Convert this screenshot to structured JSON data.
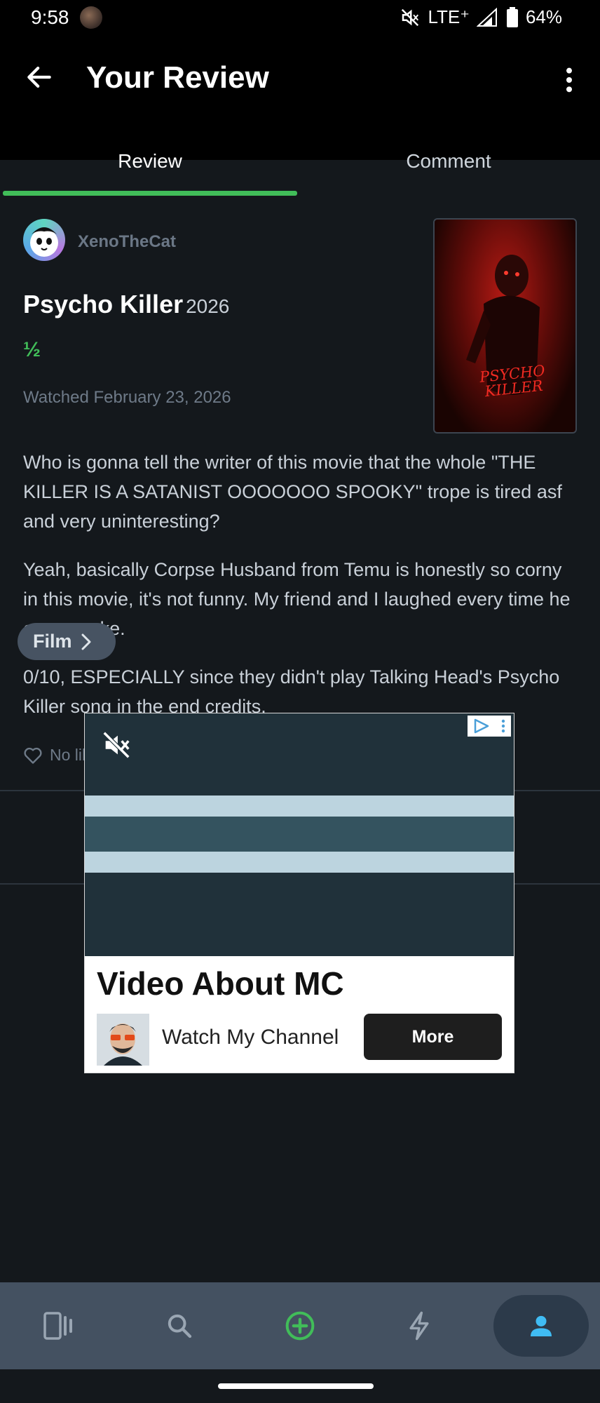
{
  "status_bar": {
    "time": "9:58",
    "network": "LTE⁺",
    "battery": "64%",
    "icons": [
      "avatar",
      "mute-icon",
      "signal-icon",
      "battery-icon"
    ]
  },
  "app_bar": {
    "title": "Your Review",
    "back_icon": "arrow-left-icon",
    "menu_icon": "more-vertical-icon"
  },
  "tabs": [
    {
      "label": "Review",
      "active": true
    },
    {
      "label": "Comment",
      "active": false
    }
  ],
  "review": {
    "username": "XenoTheCat",
    "film_title": "Psycho Killer",
    "year": "2026",
    "rating": "½",
    "watched": "Watched February 23, 2026",
    "poster_text": "PSYCHO KILLER",
    "paragraphs": [
      "Who is gonna tell the writer of this movie that the whole \"THE KILLER IS A SATANIST OOOOOOO SPOOKY\" trope is tired asf and very uninteresting?",
      "Yeah, basically Corpse Husband from Temu is honestly so corny in this movie, it's not funny. My friend and I laughed every time he even spoke.",
      "0/10, ESPECIALLY since they didn't play Talking Head's Psycho Killer song in the end credits."
    ],
    "likes": "No likes yet"
  },
  "chip": {
    "label": "Film"
  },
  "ad": {
    "headline": "Video About MC",
    "subtitle": "Watch My Channel",
    "cta": "More"
  },
  "bottom_nav": [
    {
      "icon": "films-icon",
      "active": false
    },
    {
      "icon": "search-icon",
      "active": false
    },
    {
      "icon": "add-circle-icon",
      "active": false
    },
    {
      "icon": "activity-bolt-icon",
      "active": false
    },
    {
      "icon": "profile-icon",
      "active": true
    }
  ],
  "colors": {
    "background": "#14181c",
    "accent_green": "#41bd59",
    "chip": "#475362",
    "nav_bar": "#445161",
    "profile_blue": "#40bcf4"
  }
}
